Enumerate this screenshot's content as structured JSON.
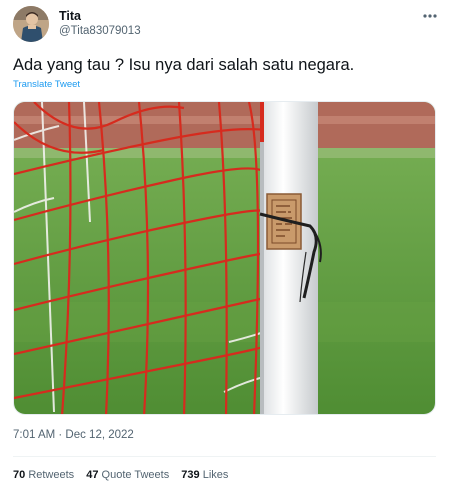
{
  "author": {
    "name": "Tita",
    "handle": "@Tita83079013"
  },
  "tweet": {
    "text": "Ada yang tau ? Isu nya dari salah satu negara.",
    "translate_label": "Translate Tweet",
    "timestamp": "7:01 AM · Dec 12, 2022"
  },
  "stats": {
    "retweets_count": "70",
    "retweets_label": "Retweets",
    "quotes_count": "47",
    "quotes_label": "Quote Tweets",
    "likes_count": "739",
    "likes_label": "Likes"
  },
  "colors": {
    "link": "#1d9bf0",
    "secondary_text": "#536471",
    "net_red": "#d62b1e",
    "grass": "#5e9a3a"
  },
  "icons": [
    "more-icon"
  ]
}
